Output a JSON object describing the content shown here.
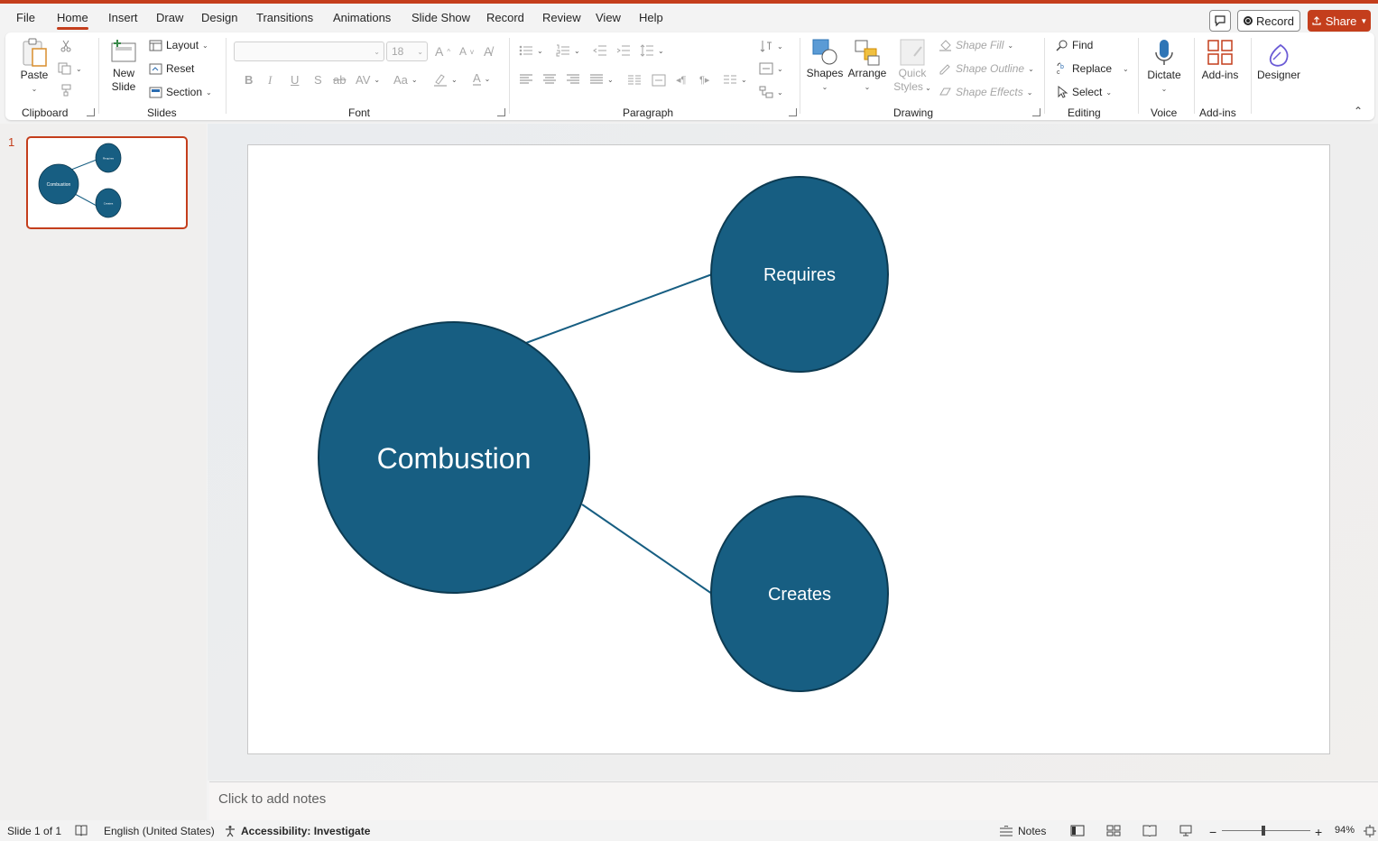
{
  "menu": {
    "tabs": [
      "File",
      "Home",
      "Insert",
      "Draw",
      "Design",
      "Transitions",
      "Animations",
      "Slide Show",
      "Record",
      "Review",
      "View",
      "Help"
    ],
    "active_tab": "Home",
    "record_label": "Record",
    "share_label": "Share"
  },
  "ribbon": {
    "clipboard": {
      "paste": "Paste",
      "group": "Clipboard"
    },
    "slides": {
      "new_slide_line1": "New",
      "new_slide_line2": "Slide",
      "layout": "Layout",
      "reset": "Reset",
      "section": "Section",
      "group": "Slides"
    },
    "font": {
      "font_name": "",
      "font_size": "18",
      "group": "Font"
    },
    "paragraph": {
      "group": "Paragraph"
    },
    "drawing": {
      "shapes": "Shapes",
      "arrange": "Arrange",
      "quick_styles_line1": "Quick",
      "quick_styles_line2": "Styles",
      "shape_fill": "Shape Fill",
      "shape_outline": "Shape Outline",
      "shape_effects": "Shape Effects",
      "group": "Drawing"
    },
    "editing": {
      "find": "Find",
      "replace": "Replace",
      "select": "Select",
      "group": "Editing"
    },
    "voice": {
      "dictate": "Dictate",
      "group": "Voice"
    },
    "addins": {
      "addins": "Add-ins",
      "group": "Add-ins"
    },
    "designer": {
      "designer": "Designer"
    }
  },
  "thumbnails": [
    {
      "number": "1",
      "center": "Combustion",
      "top": "Requires",
      "bottom": "Creates"
    }
  ],
  "slide": {
    "fill_color": "#175e82",
    "stroke_color": "#0d3b52",
    "center_label": "Combustion",
    "top_label": "Requires",
    "bottom_label": "Creates"
  },
  "notes": {
    "placeholder": "Click to add notes"
  },
  "status": {
    "slide_count": "Slide 1 of 1",
    "language": "English (United States)",
    "accessibility": "Accessibility: Investigate",
    "notes_label": "Notes",
    "zoom": "94%"
  },
  "colors": {
    "accent": "#c43e1c",
    "shape": "#175e82"
  }
}
